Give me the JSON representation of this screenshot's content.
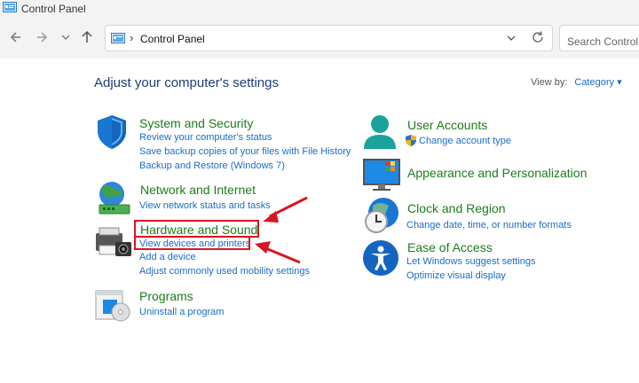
{
  "window": {
    "title": "Control Panel"
  },
  "nav": {
    "path_label": "Control Panel",
    "search_placeholder": "Search Control Panel"
  },
  "page": {
    "heading": "Adjust your computer's settings",
    "view_by_label": "View by:",
    "view_by_value": "Category ▾"
  },
  "categories": [
    {
      "title": "System and Security",
      "icon": "shield-icon",
      "links": [
        "Review your computer's status",
        "Save backup copies of your files with File History",
        "Backup and Restore (Windows 7)"
      ]
    },
    {
      "title": "Network and Internet",
      "icon": "network-icon",
      "links": [
        "View network status and tasks"
      ]
    },
    {
      "title": "Hardware and Sound",
      "icon": "printer-icon",
      "links": [
        "View devices and printers",
        "Add a device",
        "Adjust commonly used mobility settings"
      ]
    },
    {
      "title": "Programs",
      "icon": "programs-icon",
      "links": [
        "Uninstall a program"
      ]
    },
    {
      "title": "User Accounts",
      "icon": "user-icon",
      "links": [
        "Change account type"
      ]
    },
    {
      "title": "Appearance and Personalization",
      "icon": "monitor-icon",
      "links": []
    },
    {
      "title": "Clock and Region",
      "icon": "clock-icon",
      "links": [
        "Change date, time, or number formats"
      ]
    },
    {
      "title": "Ease of Access",
      "icon": "accessibility-icon",
      "links": [
        "Let Windows suggest settings",
        "Optimize visual display"
      ]
    }
  ],
  "colors": {
    "category_title": "#1e7b1e",
    "link": "#1a6cc9",
    "heading": "#1f3d7a",
    "highlight": "#d8161f"
  }
}
